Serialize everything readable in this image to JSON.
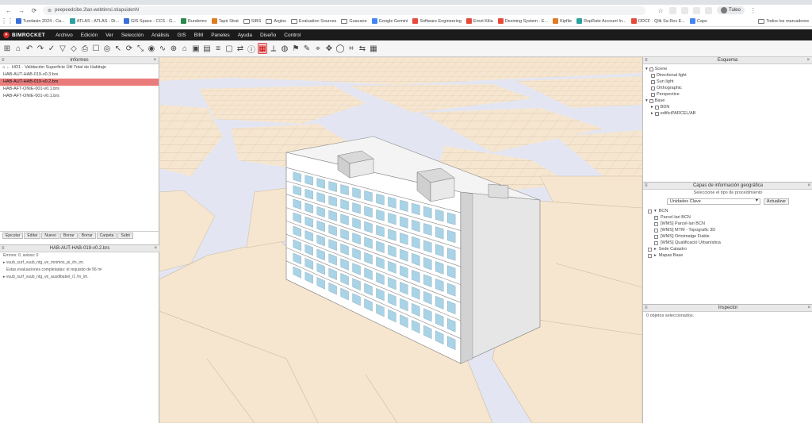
{
  "browser": {
    "url": "peepeedcibe.2lan.webtinrsi.stiapuidenN",
    "profile": "Tuleo",
    "bookmarks": [
      {
        "label": "Tundasin 2024 - Ca...",
        "color": "#3b6fd8"
      },
      {
        "label": "ATLAS - ATLAS - Di...",
        "color": "#2da0a0"
      },
      {
        "label": "GIS Space - CCS - G...",
        "color": "#3b6fd8"
      },
      {
        "label": "Rundemo",
        "color": "#2a8a4a"
      },
      {
        "label": "Tapir Strat",
        "color": "#e07b22"
      },
      {
        "label": "SIBS",
        "folder": true
      },
      {
        "label": "Arglos",
        "folder": true
      },
      {
        "label": "Evaluation Sources",
        "folder": true
      },
      {
        "label": "Guacane",
        "folder": true
      },
      {
        "label": "Google Gemini",
        "color": "#4285f4"
      },
      {
        "label": "Software Engineering",
        "color": "#e64a3b"
      },
      {
        "label": "Ernst Kilia",
        "color": "#e64a3b"
      },
      {
        "label": "Desining System · E...",
        "color": "#e64a3b"
      },
      {
        "label": "Kipfile",
        "color": "#e07b22"
      },
      {
        "label": "RopRate Account In...",
        "color": "#2da0a0"
      },
      {
        "label": "ODCF · Qlik Sa Rev E...",
        "color": "#e64a3b"
      },
      {
        "label": "Caps",
        "color": "#4285f4"
      }
    ],
    "bookmarks_more": "Todos los marcadores"
  },
  "app": {
    "brand": "BIMROCKET",
    "menu": [
      "Archivo",
      "Edición",
      "Ver",
      "Selección",
      "Análisis",
      "GIS",
      "BIM",
      "Paneles",
      "Ayuda",
      "Diseño",
      "Control"
    ]
  },
  "toolbar": {
    "icons": [
      "grid-icon",
      "home-icon",
      "undo-icon",
      "redo-icon",
      "check-icon",
      "filter-icon",
      "cube-icon",
      "print-icon",
      "bag-icon",
      "target-icon",
      "cursor-icon",
      "orbit-icon",
      "scale-icon",
      "eye-icon",
      "wave-icon",
      "zoom-icon",
      "home-view-icon",
      "box-icon",
      "layout-icon",
      "layers-icon",
      "frame-icon",
      "share-icon",
      "info-icon",
      "report-icon",
      "measure-icon",
      "sphere-icon",
      "flag-icon",
      "brush-icon",
      "pin-icon",
      "pan-icon",
      "globe-icon",
      "crop-icon",
      "swap-icon",
      "grid-alt-icon"
    ],
    "glyphs": [
      "⊞",
      "⌂",
      "↶",
      "↷",
      "✓",
      "▽",
      "◇",
      "⎙",
      "☐",
      "◎",
      "↖",
      "⟳",
      "⤡",
      "◉",
      "∿",
      "⊕",
      "⌂",
      "▣",
      "▤",
      "≡",
      "▢",
      "⇄",
      "ⓘ",
      "▦",
      "⟂",
      "◍",
      "⚑",
      "✎",
      "⌖",
      "✥",
      "◯",
      "⌗",
      "⇆",
      "▦"
    ],
    "active_index": 23
  },
  "informes": {
    "title": "Informes",
    "breadcrumb": "HO1 · Validación Superficie Útil Total de Habitaje",
    "items": [
      {
        "label": "HAB-AUT-HAB-019-v0.3.brs",
        "selected": false
      },
      {
        "label": "HAB-AUT-HAB-019-v0.2.brs",
        "selected": true
      },
      {
        "label": "HAB-AFT-ONIE-001-v0.1.brs",
        "selected": false
      },
      {
        "label": "HAB-AFT-ONIE-001-v0.1.brs",
        "selected": false
      }
    ],
    "buttons": [
      "Ejecutar",
      "Editar",
      "Nuevo",
      "Borrar",
      "Borrar",
      "Carpeta",
      "Subir"
    ]
  },
  "results": {
    "title": "HAB-AUT-HAB-019-v0.2.brs",
    "rows": [
      {
        "text": "Errores: 0, avisos: 0",
        "indent": 0
      },
      {
        "text": "▸ vuub_surf_vuub_ntg_ve_mnimos_pi_/m_im.",
        "indent": 0
      },
      {
        "text": "Estas evaluaciones completadas: el requisito de 56 m²",
        "indent": 1
      },
      {
        "text": "▸ vuub_surf_vuub_ntg_ve_ausdibabel_/1 /m_im.",
        "indent": 0
      }
    ]
  },
  "esquema": {
    "title": "Esquema",
    "rows": [
      {
        "text": "Scene",
        "level": 0,
        "toggle": "▾"
      },
      {
        "text": "Directional light",
        "level": 1
      },
      {
        "text": "Sun light",
        "level": 1
      },
      {
        "text": "Orthographic",
        "level": 1
      },
      {
        "text": "Perspective",
        "level": 1
      },
      {
        "text": "Base",
        "level": 0,
        "toggle": "▾"
      },
      {
        "text": "BDN",
        "level": 1,
        "toggle": "▸"
      },
      {
        "text": "edificiPARCEL/AB",
        "level": 1,
        "toggle": "▸"
      }
    ]
  },
  "gis": {
    "title": "Capas de información geográfica",
    "instruction": "Seleccione el tipo de procedimiento",
    "select_value": "Unidades Clave",
    "apply_label": "Actualizar",
    "layers": [
      {
        "label": "BCN",
        "checked": false,
        "toggle": "▾",
        "level": 0
      },
      {
        "label": "Parcel·lari BCN",
        "checked": true,
        "level": 1
      },
      {
        "label": "[WMS] Parcel·lari BCN",
        "checked": false,
        "level": 1
      },
      {
        "label": "[WMS] MTM - Topografic 3D",
        "checked": false,
        "level": 1
      },
      {
        "label": "[WMS] Ortoimatge Fiable",
        "checked": false,
        "level": 1
      },
      {
        "label": "[WMS] Qualificació Urbanística",
        "checked": false,
        "level": 1
      },
      {
        "label": "Sede Catastro",
        "checked": false,
        "toggle": "▸",
        "level": 0
      },
      {
        "label": "Mapas Base",
        "checked": false,
        "toggle": "▸",
        "level": 0
      }
    ]
  },
  "inspector": {
    "title": "Inspector",
    "text": "0 objetos seleccionados."
  },
  "colors": {
    "menubar": "#1b1b1b",
    "selected_row": "#e97b7b",
    "ground": "#f7e6cf",
    "street": "#e3e6f2",
    "building_face": "#ffffff",
    "window": "#a9d3e6"
  }
}
